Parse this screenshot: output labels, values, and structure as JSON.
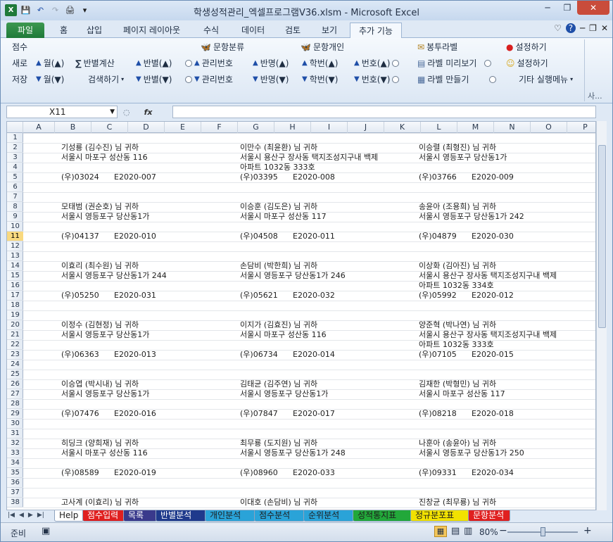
{
  "window": {
    "title": "학생성적관리_엑셀프로그램V36.xlsm  -  Microsoft Excel",
    "min": "─",
    "max": "❐",
    "close": "✕"
  },
  "qat": {
    "logo": "X",
    "save": "💾",
    "undo": "↶",
    "redo": "↷",
    "print": "🖨",
    "more": "▾"
  },
  "tabs": [
    "파일",
    "홈",
    "삽입",
    "페이지 레이아웃",
    "수식",
    "데이터",
    "검토",
    "보기",
    "추가 기능"
  ],
  "ribbon_right_icons": [
    "♡",
    "?",
    "─",
    "❐",
    "✕"
  ],
  "ribbon": {
    "row1": [
      "점수",
      "문항분류",
      "문항개인",
      "봉투라벨",
      "설정하기"
    ],
    "row2": [
      "새로",
      "월(▲)",
      "반별계산",
      "반별(▲)",
      "관리번호",
      "반명(▲)",
      "학번(▲)",
      "번호(▲)",
      "라벨 미리보기",
      "설정하기"
    ],
    "row3": [
      "저장",
      "월(▼)",
      "검색하기",
      "반별(▼)",
      "관리번호",
      "반명(▼)",
      "학번(▼)",
      "번호(▼)",
      "라벨 만들기",
      "기타 실행메뉴"
    ],
    "group_label": "사..."
  },
  "namebox": "X11",
  "fx": "fx",
  "columns": [
    "A",
    "B",
    "C",
    "D",
    "E",
    "F",
    "G",
    "H",
    "I",
    "J",
    "K",
    "L",
    "M",
    "N",
    "O",
    "P"
  ],
  "rows": [
    "1",
    "2",
    "3",
    "4",
    "5",
    "6",
    "7",
    "8",
    "9",
    "10",
    "11",
    "12",
    "13",
    "14",
    "15",
    "16",
    "17",
    "18",
    "19",
    "20",
    "21",
    "22",
    "23",
    "24",
    "25",
    "26",
    "27",
    "28",
    "29",
    "30",
    "31",
    "32",
    "33",
    "34",
    "35",
    "36",
    "37",
    "38"
  ],
  "selected_row": "11",
  "labels": [
    [
      {
        "name": "기성룡 (김수진) 님  귀하",
        "addr1": "서울시 마포구 성산동 116",
        "addr2": "",
        "post": "(우)03024",
        "id": "E2020-007"
      },
      {
        "name": "이만수 (최윤환) 님  귀하",
        "addr1": "서울시 용산구 장사동 택지조성지구내 백제",
        "addr2": "아파트 1032동 333호",
        "post": "(우)03395",
        "id": "E2020-008"
      },
      {
        "name": "이승렬 (최형진) 님  귀하",
        "addr1": "서울시 영등포구 당산동1가",
        "addr2": "",
        "post": "(우)03766",
        "id": "E2020-009"
      }
    ],
    [
      {
        "name": "모태범 (권순호) 님  귀하",
        "addr1": "서울시 영등포구 당산동1가",
        "addr2": "",
        "post": "(우)04137",
        "id": "E2020-010"
      },
      {
        "name": "이승훈 (김도은) 님  귀하",
        "addr1": "서울시 마포구 성산동 117",
        "addr2": "",
        "post": "(우)04508",
        "id": "E2020-011"
      },
      {
        "name": "송윤아 (조용희) 님  귀하",
        "addr1": "서울시 영등포구 당산동1가 242",
        "addr2": "",
        "post": "(우)04879",
        "id": "E2020-030"
      }
    ],
    [
      {
        "name": "이효리 (최수원) 님  귀하",
        "addr1": "서울시 영등포구 당산동1가 244",
        "addr2": "",
        "post": "(우)05250",
        "id": "E2020-031"
      },
      {
        "name": "손담비 (박한희) 님  귀하",
        "addr1": "서울시 영등포구 당산동1가 246",
        "addr2": "",
        "post": "(우)05621",
        "id": "E2020-032"
      },
      {
        "name": "이상화 (김아진) 님  귀하",
        "addr1": "서울시 용산구 장사동 택지조성지구내 백제",
        "addr2": "아파트 1032동 334호",
        "post": "(우)05992",
        "id": "E2020-012"
      }
    ],
    [
      {
        "name": "이정수 (김현정) 님  귀하",
        "addr1": "서울시 영등포구 당산동1가",
        "addr2": "",
        "post": "(우)06363",
        "id": "E2020-013"
      },
      {
        "name": "이지가 (김효진) 님  귀하",
        "addr1": "서울시 마포구 성산동 116",
        "addr2": "",
        "post": "(우)06734",
        "id": "E2020-014"
      },
      {
        "name": "양준혁 (박나연) 님  귀하",
        "addr1": "서울시 용산구 장사동 택지조성지구내 백제",
        "addr2": "아파트 1032동 333호",
        "post": "(우)07105",
        "id": "E2020-015"
      }
    ],
    [
      {
        "name": "이승엽 (박시내) 님  귀하",
        "addr1": "서울시 영등포구 당산동1가",
        "addr2": "",
        "post": "(우)07476",
        "id": "E2020-016"
      },
      {
        "name": "김태균 (김주연) 님  귀하",
        "addr1": "서울시 영등포구 당산동1가",
        "addr2": "",
        "post": "(우)07847",
        "id": "E2020-017"
      },
      {
        "name": "김재한 (박형민) 님  귀하",
        "addr1": "서울시 마포구 성산동 117",
        "addr2": "",
        "post": "(우)08218",
        "id": "E2020-018"
      }
    ],
    [
      {
        "name": "히딩크 (양희재) 님  귀하",
        "addr1": "서울시 마포구 성산동 116",
        "addr2": "",
        "post": "(우)08589",
        "id": "E2020-019"
      },
      {
        "name": "최무룡 (도지원) 님  귀하",
        "addr1": "서울시 영등포구 당산동1가 248",
        "addr2": "",
        "post": "(우)08960",
        "id": "E2020-033"
      },
      {
        "name": "나훈아 (송윤아) 님  귀하",
        "addr1": "서울시 영등포구 당산동1가 250",
        "addr2": "",
        "post": "(우)09331",
        "id": "E2020-034"
      }
    ],
    [
      {
        "name": "고사계 (이효리) 님  귀하",
        "addr1": "",
        "addr2": "",
        "post": "",
        "id": ""
      },
      {
        "name": "이대호 (손담비) 님  귀하",
        "addr1": "",
        "addr2": "",
        "post": "",
        "id": ""
      },
      {
        "name": "진창균 (최무룡) 님  귀하",
        "addr1": "",
        "addr2": "",
        "post": "",
        "id": ""
      }
    ]
  ],
  "sheet_tabs": [
    {
      "label": "Help",
      "color": "#f2f2f2"
    },
    {
      "label": "점수입력",
      "color": "#e02020"
    },
    {
      "label": "목록",
      "color": "#3a3a8c"
    },
    {
      "label": "반별분석",
      "color": "#1f3a8c"
    },
    {
      "label": "개인분석",
      "color": "#2aa3d8"
    },
    {
      "label": "점수분석",
      "color": "#2aa3d8"
    },
    {
      "label": "순위분석",
      "color": "#2aa3d8"
    },
    {
      "label": "성적통지표",
      "color": "#22a83a"
    },
    {
      "label": "정규분포표",
      "color": "#f2e200"
    },
    {
      "label": "문항분석",
      "color": "#e02020"
    }
  ],
  "status": {
    "ready": "준비",
    "zoom": "80%",
    "minus": "−",
    "plus": "+"
  }
}
